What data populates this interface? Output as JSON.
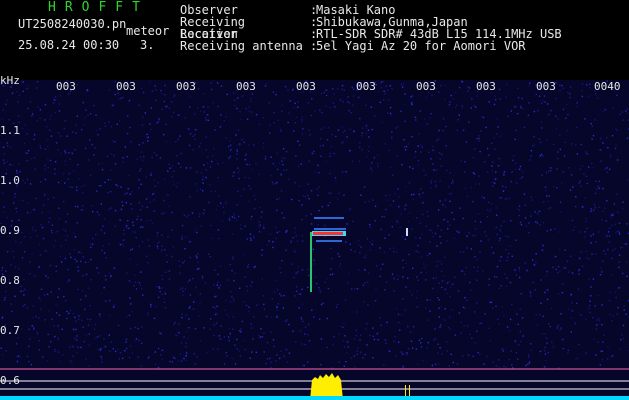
{
  "logo": "HROFFT",
  "file_name": "UT2508240030.pn",
  "tag": "meteor",
  "datetime": "25.08.24 00:30",
  "count": "3.",
  "info": [
    {
      "label": "Observer",
      "value": "Masaki Kano"
    },
    {
      "label": "Receiving Location",
      "value": "Shibukawa,Gunma,Japan"
    },
    {
      "label": "Receiver",
      "value": "RTL-SDR SDR# 43dB L15 114.1MHz USB"
    },
    {
      "label": "Receiving antenna",
      "value": "5el Yagi Az 20 for Aomori VOR"
    }
  ],
  "unit": "kHz",
  "time_ticks": [
    "003",
    "003",
    "003",
    "003",
    "003",
    "003",
    "003",
    "003",
    "003",
    "0040"
  ],
  "freq_ticks": [
    "1.1",
    "1.0",
    "0.9",
    "0.8",
    "0.7",
    "0.6"
  ],
  "colors": {
    "background": "#000000",
    "noise": "#1a1a8c",
    "signal_core": "#ff3030",
    "signal_edge": "#3fd8ff",
    "baseline": "#00d8ff",
    "burst": "#ffee00"
  }
}
